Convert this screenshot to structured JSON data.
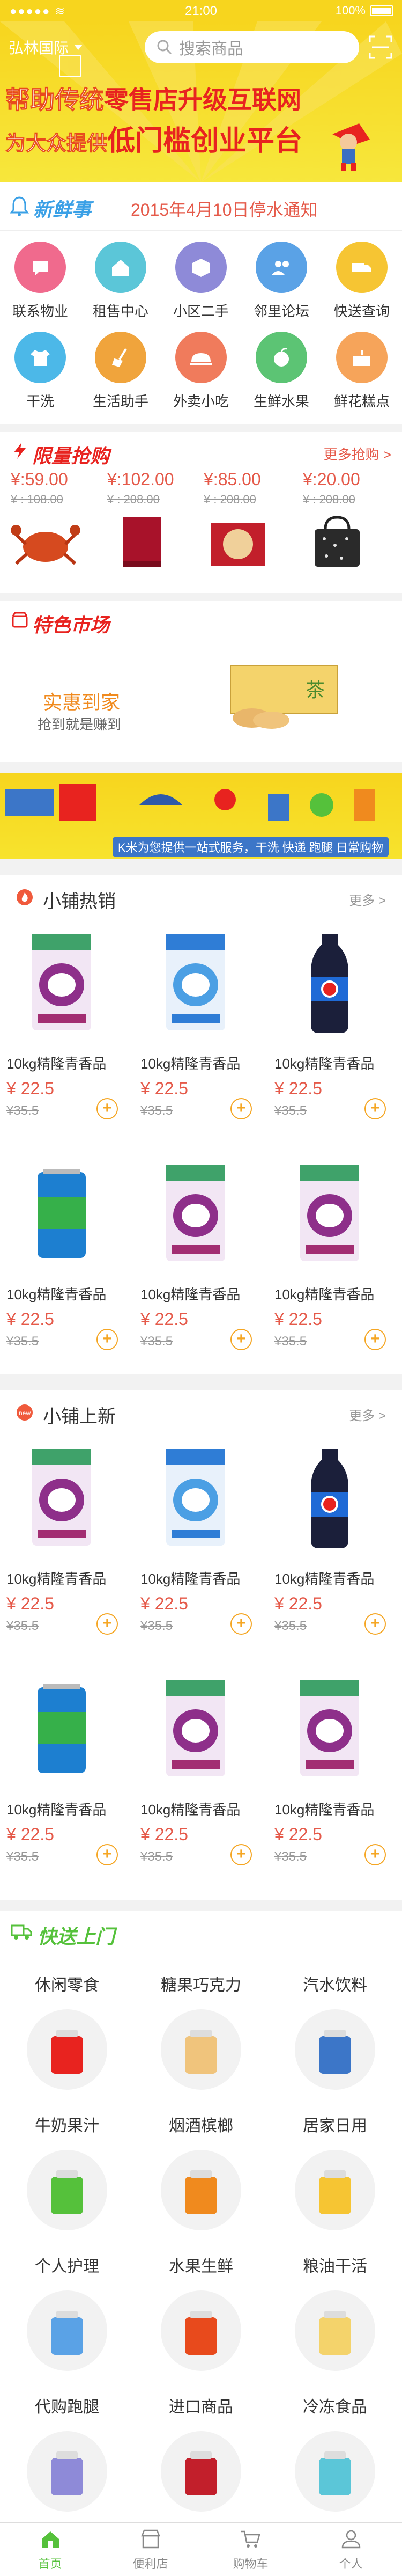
{
  "status": {
    "carrier": "●●●●● ≋",
    "time": "21:00",
    "battery": "100%"
  },
  "header": {
    "location": "弘林国际",
    "search_placeholder": "搜索商品"
  },
  "banner": {
    "line1_white": "帮助传统",
    "line1_red": "零售店升级互联网",
    "line2_white": "为大众提供",
    "line2_red": "低门槛创业平台"
  },
  "news": {
    "tag": "新鲜事",
    "text": "2015年4月10日停水通知"
  },
  "categories": [
    {
      "label": "联系物业",
      "color": "#f06a8d",
      "icon": "chat-icon"
    },
    {
      "label": "租售中心",
      "color": "#5bc6d8",
      "icon": "house-icon"
    },
    {
      "label": "小区二手",
      "color": "#8e8ad8",
      "icon": "cube-icon"
    },
    {
      "label": "邻里论坛",
      "color": "#5aa2e6",
      "icon": "people-icon"
    },
    {
      "label": "快送查询",
      "color": "#f6c533",
      "icon": "truck-icon"
    },
    {
      "label": "干洗",
      "color": "#4cb8e8",
      "icon": "shirt-icon"
    },
    {
      "label": "生活助手",
      "color": "#f0a43c",
      "icon": "broom-icon"
    },
    {
      "label": "外卖小吃",
      "color": "#f07b5c",
      "icon": "dish-icon"
    },
    {
      "label": "生鲜水果",
      "color": "#5cc474",
      "icon": "fruit-icon"
    },
    {
      "label": "鲜花糕点",
      "color": "#f6a45a",
      "icon": "cake-icon"
    }
  ],
  "flash": {
    "title": "限量抢购",
    "more": "更多抢购 >",
    "items": [
      {
        "price": "¥:59.00",
        "old": "¥ : 108.00"
      },
      {
        "price": "¥:102.00",
        "old": "¥ : 208.00"
      },
      {
        "price": "¥:85.00",
        "old": "¥ : 208.00"
      },
      {
        "price": "¥:20.00",
        "old": "¥ : 208.00"
      }
    ]
  },
  "special": {
    "title": "特色市场",
    "big": "实惠到家",
    "sub": "抢到就是赚到",
    "box_text": "茶"
  },
  "banner2": {
    "tagline": "K米为您提供一站式服务，干洗 快递 跑腿 日常购物"
  },
  "hot": {
    "title": "小铺热销",
    "more": "更多 >",
    "products": [
      {
        "name": "10kg精隆青香品",
        "price": "¥ 22.5",
        "old": "¥35.5",
        "kind": "rice-purple"
      },
      {
        "name": "10kg精隆青香品",
        "price": "¥ 22.5",
        "old": "¥35.5",
        "kind": "rice-blue"
      },
      {
        "name": "10kg精隆青香品",
        "price": "¥ 22.5",
        "old": "¥35.5",
        "kind": "cola"
      },
      {
        "name": "10kg精隆青香品",
        "price": "¥ 22.5",
        "old": "¥35.5",
        "kind": "can"
      },
      {
        "name": "10kg精隆青香品",
        "price": "¥ 22.5",
        "old": "¥35.5",
        "kind": "rice-purple"
      },
      {
        "name": "10kg精隆青香品",
        "price": "¥ 22.5",
        "old": "¥35.5",
        "kind": "rice-purple"
      }
    ]
  },
  "new": {
    "title": "小铺上新",
    "more": "更多 >",
    "products": [
      {
        "name": "10kg精隆青香品",
        "price": "¥ 22.5",
        "old": "¥35.5",
        "kind": "rice-purple"
      },
      {
        "name": "10kg精隆青香品",
        "price": "¥ 22.5",
        "old": "¥35.5",
        "kind": "rice-blue"
      },
      {
        "name": "10kg精隆青香品",
        "price": "¥ 22.5",
        "old": "¥35.5",
        "kind": "cola"
      },
      {
        "name": "10kg精隆青香品",
        "price": "¥ 22.5",
        "old": "¥35.5",
        "kind": "can"
      },
      {
        "name": "10kg精隆青香品",
        "price": "¥ 22.5",
        "old": "¥35.5",
        "kind": "rice-purple"
      },
      {
        "name": "10kg精隆青香品",
        "price": "¥ 22.5",
        "old": "¥35.5",
        "kind": "rice-purple"
      }
    ]
  },
  "fast": {
    "title": "快送上门",
    "cats": [
      "休闲零食",
      "糖果巧克力",
      "汽水饮料",
      "牛奶果汁",
      "烟酒槟榔",
      "居家日用",
      "个人护理",
      "水果生鲜",
      "粮油干活",
      "代购跑腿",
      "进口商品",
      "冷冻食品"
    ]
  },
  "tabs": [
    {
      "label": "首页",
      "active": true
    },
    {
      "label": "便利店",
      "active": false
    },
    {
      "label": "购物车",
      "active": false
    },
    {
      "label": "个人",
      "active": false
    }
  ],
  "colors": {
    "yellow": "#f7d51e",
    "red": "#e8231f",
    "price": "#e55a4a",
    "green": "#55c13b",
    "orange": "#f5a623"
  }
}
